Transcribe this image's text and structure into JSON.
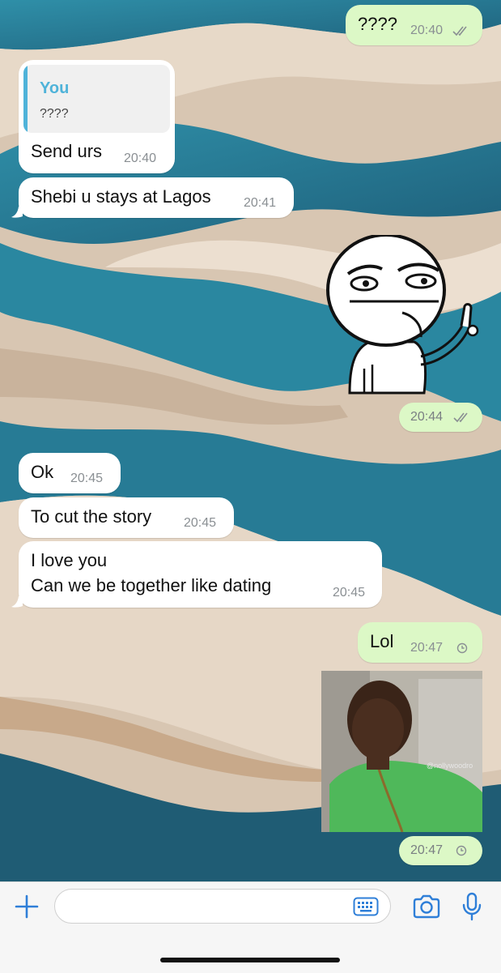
{
  "accent_color": "#2f7fd8",
  "outgoing_bubble_color": "#dcf8c6",
  "incoming_bubble_color": "#ffffff",
  "messages": [
    {
      "direction": "out",
      "text": "????",
      "time": "20:40",
      "status": "read"
    },
    {
      "direction": "in",
      "quote": {
        "author": "You",
        "text": "????"
      },
      "text": "Send urs",
      "time": "20:40"
    },
    {
      "direction": "in",
      "text": "Shebi u stays at Lagos",
      "time": "20:41"
    },
    {
      "direction": "out",
      "type": "sticker",
      "sticker_icon": "meme-middle-finger-sticker",
      "time": "20:44",
      "status": "read"
    },
    {
      "direction": "in",
      "text": "Ok",
      "time": "20:45"
    },
    {
      "direction": "in",
      "text": "To cut the story",
      "time": "20:45"
    },
    {
      "direction": "in",
      "lines": [
        "I love you",
        "Can we be together like dating"
      ],
      "time": "20:45"
    },
    {
      "direction": "out",
      "text": "Lol",
      "time": "20:47",
      "status": "pending"
    },
    {
      "direction": "out",
      "type": "image",
      "watermark": "@nollywoodro",
      "time": "20:47",
      "status": "pending"
    }
  ],
  "composer": {
    "placeholder": "",
    "icons": [
      "plus-icon",
      "keyboard-icon",
      "camera-icon",
      "microphone-icon"
    ]
  }
}
